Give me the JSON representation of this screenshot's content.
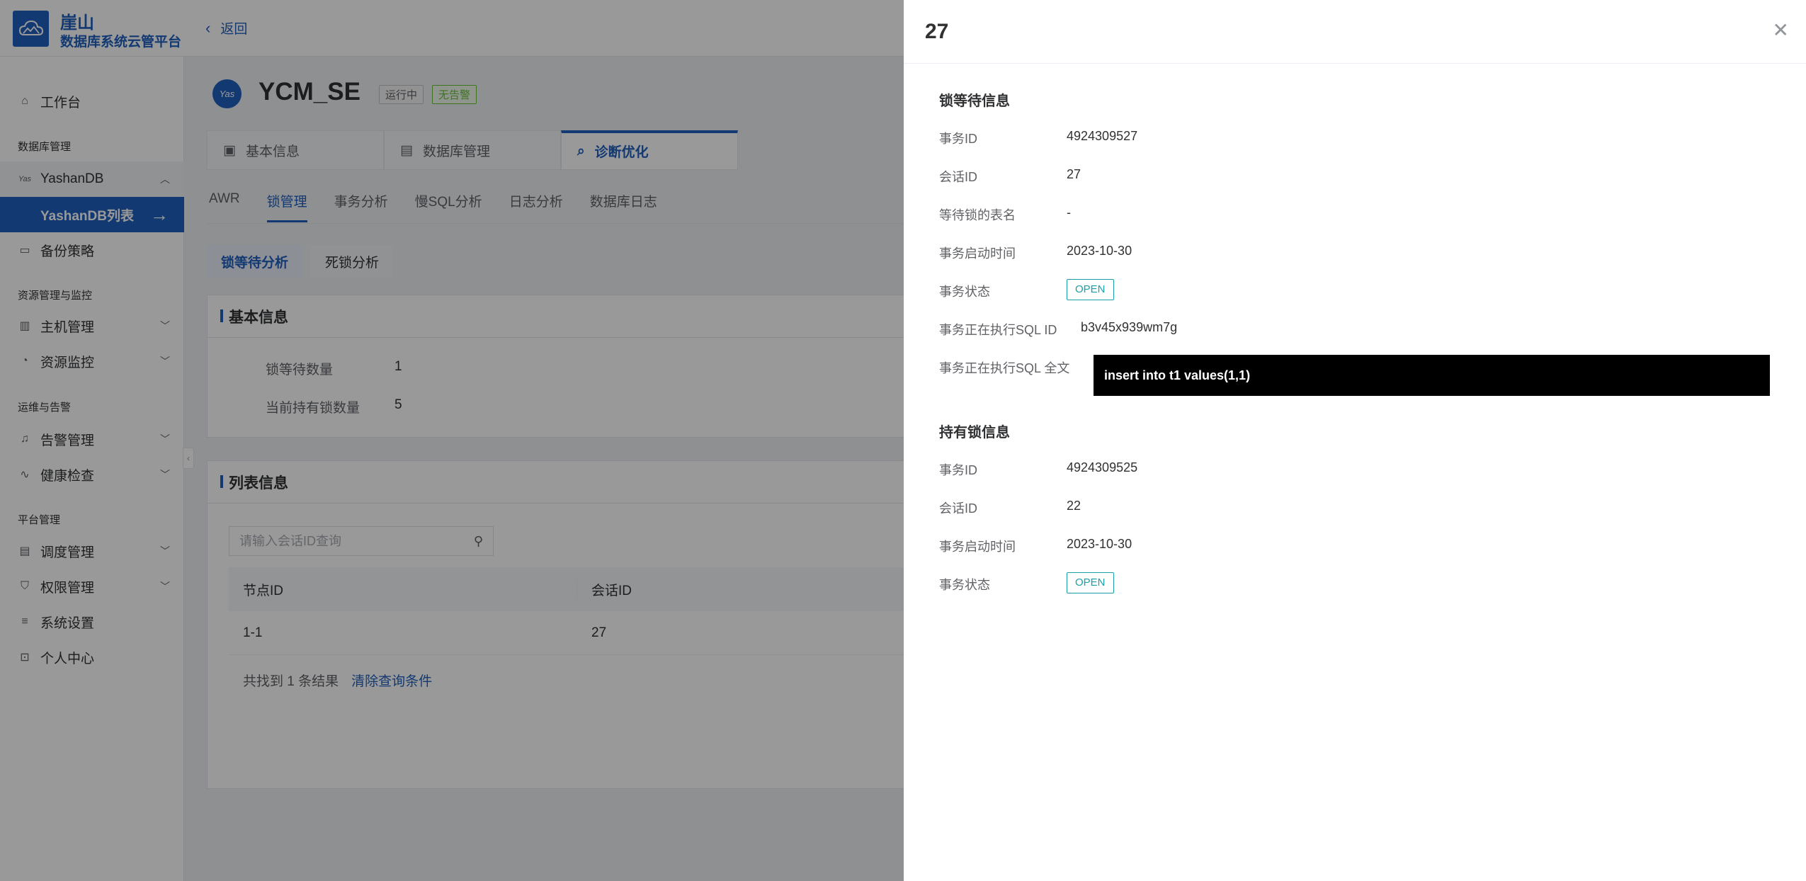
{
  "app": {
    "brand_name": "崖山",
    "brand_sub": "数据库系统云管平台",
    "back_label": "返回"
  },
  "sidebar": {
    "workbench": "工作台",
    "group_db": "数据库管理",
    "yashandb": "YashanDB",
    "yashandb_list": "YashanDB列表",
    "backup": "备份策略",
    "group_resource": "资源管理与监控",
    "host_mgmt": "主机管理",
    "resource_monitor": "资源监控",
    "group_ops": "运维与告警",
    "alert_mgmt": "告警管理",
    "health_check": "健康检查",
    "group_platform": "平台管理",
    "schedule_mgmt": "调度管理",
    "permission_mgmt": "权限管理",
    "system_settings": "系统设置",
    "personal_center": "个人中心"
  },
  "instance": {
    "icon_text": "Yas",
    "name": "YCM_SE",
    "status": "运行中",
    "alarm": "无告警"
  },
  "main_tabs": {
    "basic": "基本信息",
    "db_mgmt": "数据库管理",
    "diagnose": "诊断优化"
  },
  "sub_tabs": {
    "awr": "AWR",
    "lock": "锁管理",
    "txn": "事务分析",
    "slow_sql": "慢SQL分析",
    "log": "日志分析",
    "db_log": "数据库日志"
  },
  "pill_tabs": {
    "lock_wait": "锁等待分析",
    "deadlock": "死锁分析"
  },
  "basic_card": {
    "title": "基本信息",
    "wait_count_label": "锁等待数量",
    "wait_count": "1",
    "hold_count_label": "当前持有锁数量",
    "hold_count": "5"
  },
  "list_card": {
    "title": "列表信息",
    "search_placeholder": "请输入会话ID查询",
    "col_node": "节点ID",
    "col_session": "会话ID",
    "row_node": "1-1",
    "row_session": "27",
    "result_text": "共找到 1 条结果",
    "clear_link": "清除查询条件"
  },
  "drawer": {
    "title": "27",
    "wait_section": "锁等待信息",
    "wait_txn_id_label": "事务ID",
    "wait_txn_id": "4924309527",
    "wait_session_label": "会话ID",
    "wait_session": "27",
    "wait_table_label": "等待锁的表名",
    "wait_table": "-",
    "wait_start_label": "事务启动时间",
    "wait_start": "2023-10-30",
    "wait_state_label": "事务状态",
    "wait_state": "OPEN",
    "sql_id_label": "事务正在执行SQL ID",
    "sql_id": "b3v45x939wm7g",
    "sql_text_label": "事务正在执行SQL 全文",
    "sql_text": "insert into t1 values(1,1)",
    "hold_section": "持有锁信息",
    "hold_txn_id_label": "事务ID",
    "hold_txn_id": "4924309525",
    "hold_session_label": "会话ID",
    "hold_session": "22",
    "hold_start_label": "事务启动时间",
    "hold_start": "2023-10-30",
    "hold_state_label": "事务状态",
    "hold_state": "OPEN"
  }
}
